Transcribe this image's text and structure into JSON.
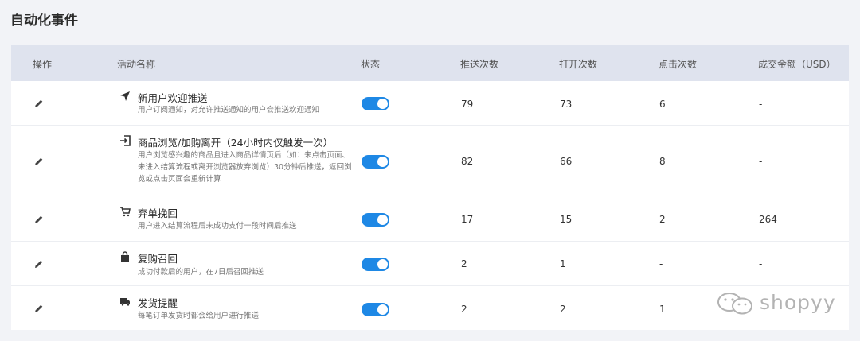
{
  "page": {
    "title": "自动化事件"
  },
  "table": {
    "headers": {
      "action": "操作",
      "name": "活动名称",
      "status": "状态",
      "sends": "推送次数",
      "opens": "打开次数",
      "clicks": "点击次数",
      "revenue": "成交金额（USD）"
    },
    "rows": [
      {
        "icon": "send-icon",
        "name": "新用户欢迎推送",
        "desc": "用户订阅通知，对允许推送通知的用户会推送欢迎通知",
        "status": "on",
        "sends": "79",
        "opens": "73",
        "clicks": "6",
        "revenue": "-"
      },
      {
        "icon": "exit-icon",
        "name": "商品浏览/加购离开（24小时内仅触发一次）",
        "desc": "用户浏览感兴趣的商品且进入商品详情页后（如：未点击页面、未进入结算流程或离开浏览器放弃浏览）30分钟后推送，返回浏览或点击页面会重新计算",
        "status": "on",
        "sends": "82",
        "opens": "66",
        "clicks": "8",
        "revenue": "-"
      },
      {
        "icon": "cart-icon",
        "name": "弃单挽回",
        "desc": "用户进入结算流程后未成功支付一段时间后推送",
        "status": "on",
        "sends": "17",
        "opens": "15",
        "clicks": "2",
        "revenue": "264"
      },
      {
        "icon": "shopping-bag-icon",
        "name": "复购召回",
        "desc": "成功付款后的用户，在7日后召回推送",
        "status": "on",
        "sends": "2",
        "opens": "1",
        "clicks": "-",
        "revenue": "-"
      },
      {
        "icon": "truck-icon",
        "name": "发货提醒",
        "desc": "每笔订单发货时都会给用户进行推送",
        "status": "on",
        "sends": "2",
        "opens": "2",
        "clicks": "1",
        "revenue": ""
      }
    ]
  },
  "watermark": {
    "text": "shopyy"
  }
}
